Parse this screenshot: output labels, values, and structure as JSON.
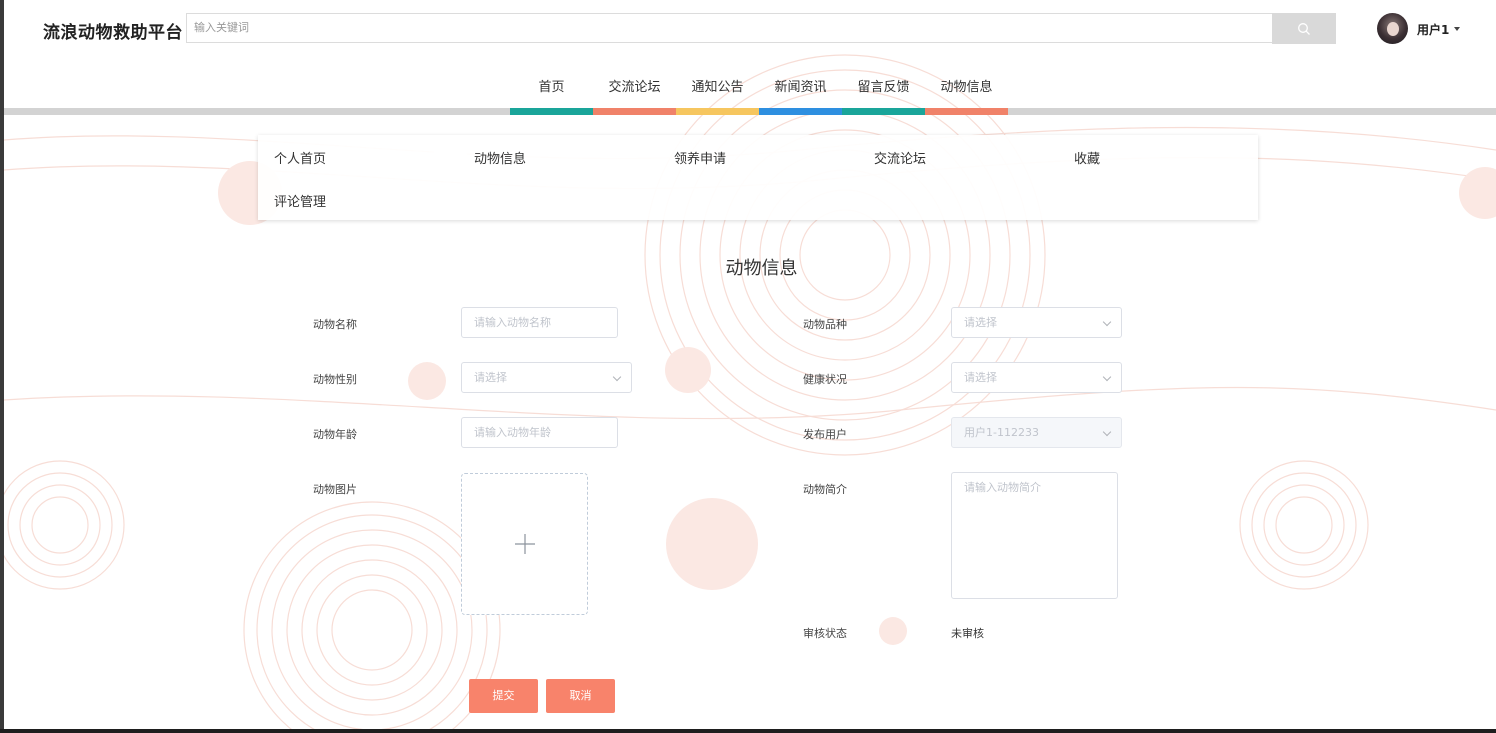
{
  "header": {
    "brand": "流浪动物救助平台",
    "search": {
      "placeholder": "输入关键词",
      "icon": "search-icon"
    },
    "user": {
      "name": "用户1",
      "icon": "chevron-down-icon"
    }
  },
  "nav": {
    "items": [
      {
        "label": "首页",
        "color": "#1aa59a"
      },
      {
        "label": "交流论坛",
        "color": "#f08269"
      },
      {
        "label": "通知公告",
        "color": "#f6c65f"
      },
      {
        "label": "新闻资讯",
        "color": "#2e8fe0"
      },
      {
        "label": "留言反馈",
        "color": "#1aa59a"
      },
      {
        "label": "动物信息",
        "color": "#f08269"
      }
    ]
  },
  "center_menu": {
    "items": [
      "个人首页",
      "动物信息",
      "领养申请",
      "交流论坛",
      "收藏",
      "评论管理"
    ]
  },
  "form": {
    "title": "动物信息",
    "fields": {
      "name": {
        "label": "动物名称",
        "placeholder": "请输入动物名称"
      },
      "breed": {
        "label": "动物品种",
        "placeholder": "请选择"
      },
      "gender": {
        "label": "动物性别",
        "placeholder": "请选择"
      },
      "health": {
        "label": "健康状况",
        "placeholder": "请选择"
      },
      "age": {
        "label": "动物年龄",
        "placeholder": "请输入动物年龄"
      },
      "publisher": {
        "label": "发布用户",
        "value": "用户1-112233"
      },
      "image": {
        "label": "动物图片",
        "icon": "plus-icon"
      },
      "intro": {
        "label": "动物简介",
        "placeholder": "请输入动物简介"
      },
      "review": {
        "label": "审核状态",
        "value": "未审核"
      }
    },
    "buttons": {
      "submit": "提交",
      "cancel": "取消"
    }
  },
  "colors": {
    "accent": "#f8836b"
  }
}
